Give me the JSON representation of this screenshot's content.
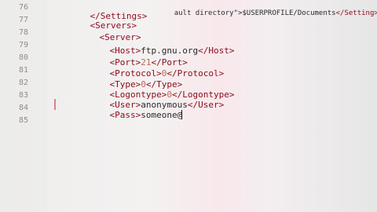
{
  "lines": [
    {
      "no": "76",
      "open": "</Settings>",
      "value": "",
      "close": ""
    },
    {
      "no": "77",
      "open": "<Servers>",
      "value": "",
      "close": ""
    },
    {
      "no": "78",
      "open": "<Server>",
      "value": "",
      "close": ""
    },
    {
      "no": "79",
      "open": "<Host>",
      "value": "ftp.gnu.org",
      "close": "</Host>"
    },
    {
      "no": "80",
      "open": "<Port>",
      "value": "21",
      "close": "</Port>"
    },
    {
      "no": "81",
      "open": "<Protocol>",
      "value": "0",
      "close": "</Protocol>"
    },
    {
      "no": "82",
      "open": "<Type>",
      "value": "0",
      "close": "</Type>"
    },
    {
      "no": "83",
      "open": "<Logontype>",
      "value": "0",
      "close": "</Logontype>"
    },
    {
      "no": "84",
      "open": "<User>",
      "value": "anonymous",
      "close": "</User>"
    },
    {
      "no": "84",
      "open": "<Pass>",
      "value": "someone@",
      "close": ""
    },
    {
      "no": "85",
      "open": "",
      "value": "",
      "close": ""
    }
  ],
  "top_partial": {
    "before": "ault directory\">",
    "path": "$USERPROFILE/Documents",
    "close": "</Setting>"
  },
  "theme": {
    "tag_color": "#8b0a1a",
    "line_number_color": "#8c8c8c",
    "cursor_line_marker": "#e0808a"
  }
}
